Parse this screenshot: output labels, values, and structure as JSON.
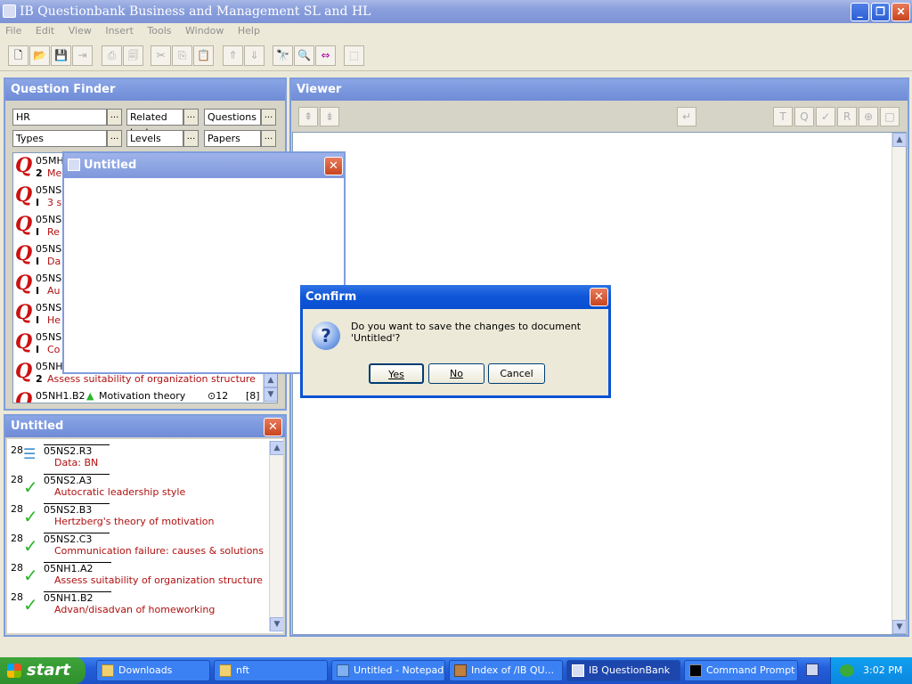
{
  "window": {
    "title": "IB Questionbank Business and Management SL and HL"
  },
  "menu": [
    "File",
    "Edit",
    "View",
    "Insert",
    "Tools",
    "Window",
    "Help"
  ],
  "finder": {
    "title": "Question Finder",
    "filters": [
      {
        "value": "HR",
        "btn": "..."
      },
      {
        "value": "Related text",
        "btn": "..."
      },
      {
        "value": "Questions",
        "btn": "..."
      },
      {
        "value": "Types",
        "btn": "..."
      },
      {
        "value": "Levels",
        "btn": "..."
      },
      {
        "value": "Papers",
        "btn": "..."
      }
    ],
    "items": [
      {
        "code": "05MH",
        "level": "2",
        "text": "Me"
      },
      {
        "code": "05NS",
        "level": "I",
        "text": "3 s"
      },
      {
        "code": "05NS",
        "level": "I",
        "text": "Re"
      },
      {
        "code": "05NS",
        "level": "I",
        "text": "Da"
      },
      {
        "code": "05NS",
        "level": "I",
        "text": "Au"
      },
      {
        "code": "05NS",
        "level": "I",
        "text": "He"
      },
      {
        "code": "05NS",
        "level": "I",
        "text": "Co"
      },
      {
        "code": "05NH",
        "level": "2",
        "text": "Assess suitability of organization structure"
      }
    ],
    "last_item": {
      "code": "05NH1.B2",
      "text": "Motivation theory",
      "marks": "⊙12",
      "bracket": "[8]"
    }
  },
  "untitled_float": {
    "title": "Untitled"
  },
  "untitled_panel": {
    "title": "Untitled",
    "items": [
      {
        "num": "28",
        "code": "05NS2.R3",
        "text": "Data: BN"
      },
      {
        "num": "28",
        "code": "05NS2.A3",
        "text": "Autocratic leadership style"
      },
      {
        "num": "28",
        "code": "05NS2.B3",
        "text": "Hertzberg's theory of motivation"
      },
      {
        "num": "28",
        "code": "05NS2.C3",
        "text": "Communication failure: causes & solutions"
      },
      {
        "num": "28",
        "code": "05NH1.A2",
        "text": "Assess suitability of organization structure"
      },
      {
        "num": "28",
        "code": "05NH1.B2",
        "text": "Advan/disadvan of homeworking"
      }
    ]
  },
  "viewer": {
    "title": "Viewer",
    "tools": [
      "T",
      "Q",
      "✓",
      "R",
      "⊕",
      "□"
    ]
  },
  "confirm": {
    "title": "Confirm",
    "message": "Do you want to save the changes to document 'Untitled'?",
    "yes": "Yes",
    "no": "No",
    "cancel": "Cancel",
    "icon": "?"
  },
  "taskbar": {
    "start": "start",
    "tasks": [
      "Downloads",
      "nft",
      "Untitled - Notepad",
      "Index of /IB QU...",
      "IB QuestionBank",
      "Command Prompt"
    ],
    "clock": "3:02 PM"
  },
  "colors": {
    "accent": "#0a53d6",
    "panel_title": "#6e8bd6",
    "red_text": "#b01010",
    "check": "#2bb52b"
  }
}
